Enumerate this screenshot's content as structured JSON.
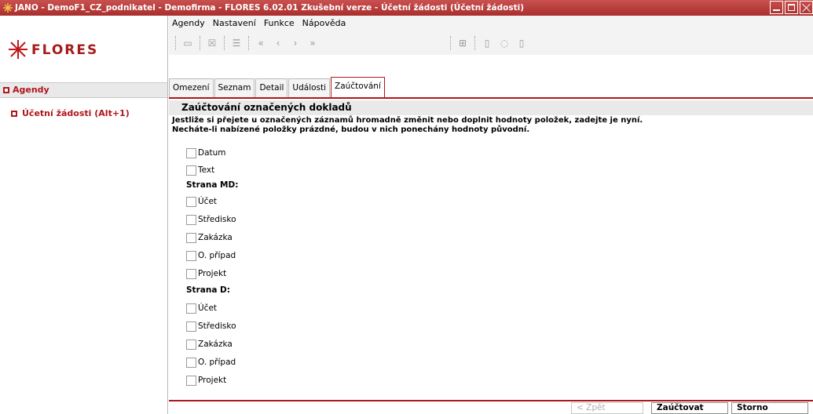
{
  "window": {
    "title": "JANO - DemoF1_CZ_podnikatel - Demofirma - FLORES 6.02.01 Zkušební verze - Účetní žádosti  (Účetní žádosti)"
  },
  "sidebar": {
    "logo_text": "FLORES",
    "agendy_label": "Agendy",
    "items": [
      {
        "label": "Účetní žádosti (Alt+1)"
      }
    ]
  },
  "menu": {
    "items": [
      "Agendy",
      "Nastavení",
      "Funkce",
      "Nápověda"
    ]
  },
  "toolbar": {
    "icons": [
      "open-folder-icon",
      "close-icon",
      "list-icon",
      "first-icon",
      "prev-icon",
      "next-icon",
      "last-icon",
      "grid-icon",
      "info-icon",
      "chat-icon",
      "help-icon"
    ]
  },
  "tabs": [
    "Omezení",
    "Seznam",
    "Detail",
    "Události",
    "Zaúčtování"
  ],
  "active_tab": "Zaúčtování",
  "form": {
    "heading": "Zaúčtování označených dokladů",
    "desc1": "Jestliže si přejete u označených záznamů hromadně změnit nebo doplnit hodnoty položek, zadejte je nyní.",
    "desc2": "Necháte-li nabízené položky prázdné, budou v nich ponechány hodnoty původní.",
    "general": [
      "Datum",
      "Text"
    ],
    "md_title": "Strana MD:",
    "md": [
      "Účet",
      "Středisko",
      "Zakázka",
      "O. případ",
      "Projekt"
    ],
    "d_title": "Strana D:",
    "d": [
      "Účet",
      "Středisko",
      "Zakázka",
      "O. případ",
      "Projekt"
    ]
  },
  "footer": {
    "back": "< Zpět",
    "post": "Zaúčtovat",
    "cancel": "Storno"
  },
  "colors": {
    "accent": "#b0161a",
    "title_bar": "#b83a39"
  }
}
